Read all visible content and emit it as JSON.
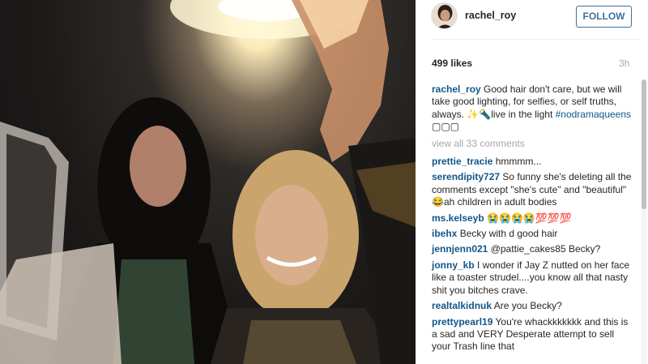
{
  "header": {
    "username": "rachel_roy",
    "follow_label": "FOLLOW"
  },
  "meta": {
    "likes": "499 likes",
    "time": "3h"
  },
  "caption": {
    "user": "rachel_roy",
    "text": "Good hair don't care, but we will take good lighting, for selfies, or self truths, always. ✨🔦live in the light ",
    "hashtag": "#nodramaqueens",
    "trail": " ▢▢▢"
  },
  "view_all": "view all 33 comments",
  "comments": [
    {
      "user": "prettie_tracie",
      "text": "hmmmm..."
    },
    {
      "user": "serendipity727",
      "text": "So funny she's deleting all the comments except \"she's cute\" and \"beautiful\" 😂ah children in adult bodies"
    },
    {
      "user": "ms.kelseyb",
      "text": "😭😭😭😭💯💯💯"
    },
    {
      "user": "ibehx",
      "text": "Becky with d good hair"
    },
    {
      "user": "jennjenn021",
      "text": "@pattie_cakes85 Becky?"
    },
    {
      "user": "jonny_kb",
      "text": "I wonder if Jay Z nutted on her face like a toaster strudel....you know all that nasty shit you bitches crave."
    },
    {
      "user": "realtalkidnuk",
      "text": "Are you Becky?"
    },
    {
      "user": "prettypearl19",
      "text": "You're whackkkkkkk and this is a sad and VERY Desperate attempt to sell your Trash line that"
    }
  ],
  "colors": {
    "username_blue": "#125688",
    "follow_blue": "#3f729b",
    "muted_gray": "#a5a7aa"
  }
}
